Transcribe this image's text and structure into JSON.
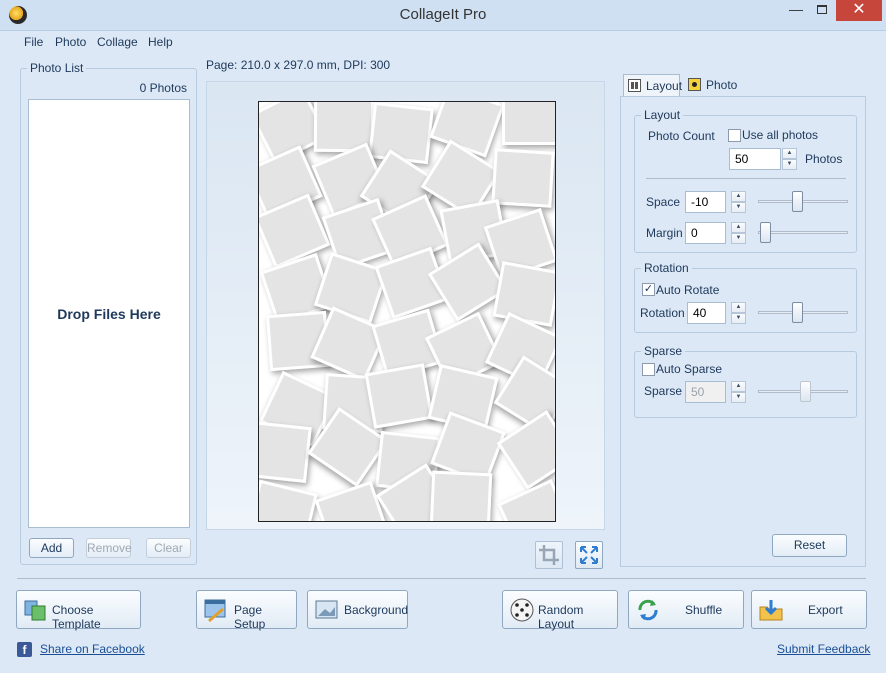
{
  "window": {
    "title": "CollageIt Pro",
    "minimize": "—",
    "close": "✕"
  },
  "menu": [
    "File",
    "Photo",
    "Collage",
    "Help"
  ],
  "photo_list": {
    "title": "Photo List",
    "count": "0 Photos",
    "drop_text": "Drop Files Here",
    "add_label": "Add",
    "remove_label": "Remove",
    "clear_label": "Clear"
  },
  "page_info": "Page: 210.0 x 297.0 mm, DPI: 300",
  "tabs": {
    "layout": "Layout",
    "photo": "Photo"
  },
  "layout_group": {
    "title": "Layout",
    "photo_count_label": "Photo Count",
    "use_all_photos_label": "Use all photos",
    "use_all_photos_checked": false,
    "photo_count_value": "50",
    "photos_unit": "Photos",
    "space_label": "Space",
    "space_value": "-10",
    "space_level": 0.4,
    "margin_label": "Margin",
    "margin_value": "0",
    "margin_level": 0.0
  },
  "rotation_group": {
    "title": "Rotation",
    "auto_rotate_label": "Auto Rotate",
    "auto_rotate_checked": true,
    "check_mark": "✓",
    "rotation_label": "Rotation",
    "rotation_value": "40",
    "rotation_level": 0.4
  },
  "sparse_group": {
    "title": "Sparse",
    "auto_sparse_label": "Auto Sparse",
    "auto_sparse_checked": false,
    "sparse_label": "Sparse",
    "sparse_value": "50",
    "sparse_level": 0.5
  },
  "reset_label": "Reset",
  "spin_up": "▲",
  "spin_down": "▼",
  "bottom_buttons": {
    "choose_template": "Choose Template",
    "page_setup": "Page Setup",
    "background": "Background",
    "random_layout": "Random Layout",
    "shuffle": "Shuffle",
    "export": "Export"
  },
  "footer": {
    "share_facebook": "Share on Facebook",
    "fb_glyph": "f",
    "submit_feedback": "Submit Feedback"
  },
  "colors": {
    "accent": "#1e395b",
    "link": "#1a4f96",
    "close": "#c7463b"
  }
}
